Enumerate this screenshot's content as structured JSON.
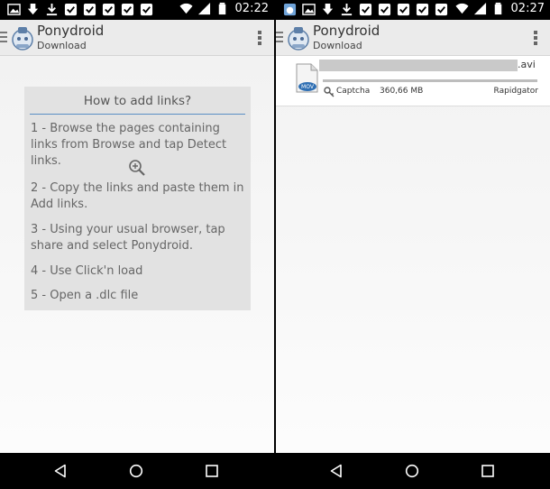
{
  "left_screen": {
    "status_time": "02:22",
    "app_title": "Ponydroid",
    "app_subtitle": "Download",
    "help": {
      "title": "How to add links?",
      "items": [
        "1 - Browse the pages containing links from Browse and tap Detect links.",
        "2 - Copy the links and paste them in Add links.",
        "3 - Using your usual browser, tap share and select Ponydroid.",
        "4 - Use Click'n load",
        "5 - Open a .dlc file"
      ]
    }
  },
  "right_screen": {
    "status_time": "02:27",
    "app_title": "Ponydroid",
    "app_subtitle": "Download",
    "download": {
      "file_ext": ".avi",
      "file_type_badge": "MOV",
      "status": "Captcha",
      "size": "360,66 MB",
      "host": "Rapidgator"
    }
  },
  "icons": [
    "image-icon",
    "download-arrow-icon",
    "download-icon",
    "checkbox-icon",
    "wifi-icon",
    "signal-icon",
    "battery-icon",
    "zoom-in-icon",
    "key-icon",
    "file-mov-icon",
    "back-icon",
    "home-icon",
    "recents-icon"
  ],
  "colors": {
    "accent": "#5a8fc4",
    "actionbar": "#ebebeb",
    "helpbox": "#e2e2e2"
  }
}
